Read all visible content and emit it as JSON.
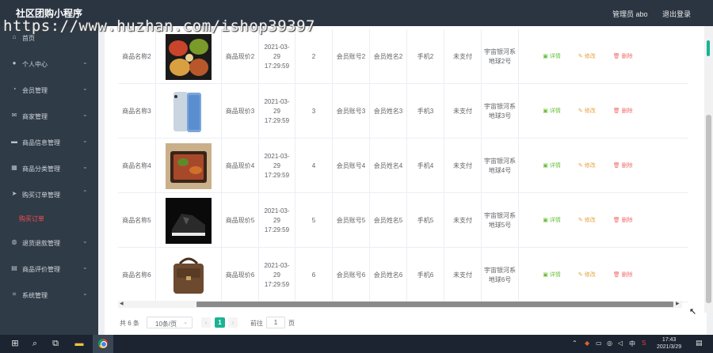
{
  "header": {
    "title": "社区团购小程序",
    "admin": "管理员 abo",
    "logout": "退出登录"
  },
  "watermark": "https://www.huzhan.com/ishop39397",
  "sidebar": {
    "items": [
      {
        "label": "首页",
        "icon": "home-icon"
      },
      {
        "label": "个人中心",
        "icon": "user-icon"
      },
      {
        "label": "会员管理",
        "icon": "help-circle-icon"
      },
      {
        "label": "商家管理",
        "icon": "mail-icon"
      },
      {
        "label": "商品信息管理",
        "icon": "monitor-icon"
      },
      {
        "label": "商品分类管理",
        "icon": "chart-icon"
      },
      {
        "label": "购买订单管理",
        "icon": "send-icon"
      },
      {
        "label": "退货退款管理",
        "icon": "bulb-icon"
      },
      {
        "label": "商品评价管理",
        "icon": "table-icon"
      },
      {
        "label": "系统管理",
        "icon": "crop-icon"
      }
    ],
    "active_sub": "购买订单"
  },
  "table": {
    "rows": [
      {
        "name": "商品名称2",
        "img": "food-tray-image",
        "price": "商品现价2",
        "time": "2021-03-29 17:29:59",
        "qty": "2",
        "account": "会员账号2",
        "member": "会员姓名2",
        "phone": "手机2",
        "status": "未支付",
        "address": "宇宙银河系地球2号"
      },
      {
        "name": "商品名称3",
        "img": "smartphone-image",
        "price": "商品现价3",
        "time": "2021-03-29 17:29:59",
        "qty": "3",
        "account": "会员账号3",
        "member": "会员姓名3",
        "phone": "手机3",
        "status": "未支付",
        "address": "宇宙银河系地球3号"
      },
      {
        "name": "商品名称4",
        "img": "meal-box-image",
        "price": "商品现价4",
        "time": "2021-03-29 17:29:59",
        "qty": "4",
        "account": "会员账号4",
        "member": "会员姓名4",
        "phone": "手机4",
        "status": "未支付",
        "address": "宇宙银河系地球4号"
      },
      {
        "name": "商品名称5",
        "img": "sneaker-image",
        "price": "商品现价5",
        "time": "2021-03-29 17:29:59",
        "qty": "5",
        "account": "会员账号5",
        "member": "会员姓名5",
        "phone": "手机5",
        "status": "未支付",
        "address": "宇宙银河系地球5号"
      },
      {
        "name": "商品名称6",
        "img": "leather-bag-image",
        "price": "商品现价6",
        "time": "2021-03-29 17:29:59",
        "qty": "6",
        "account": "会员账号6",
        "member": "会员姓名6",
        "phone": "手机6",
        "status": "未支付",
        "address": "宇宙银河系地球6号"
      }
    ],
    "actions": {
      "detail": "详情",
      "edit": "修改",
      "delete": "删除"
    }
  },
  "pagination": {
    "total": "共 6 条",
    "page_size": "10条/页",
    "prev": "‹",
    "current": "1",
    "next": "›",
    "goto": "前往",
    "jump_value": "1",
    "page_suffix": "页"
  },
  "taskbar": {
    "tray_lang": "中",
    "time": "17:43",
    "date": "2021/3/29"
  },
  "colors": {
    "topbar": "#2b3542",
    "sidebar": "#2f3b47",
    "active": "#ff4d4f",
    "pager_active": "#19b394",
    "detail": "#67c23a",
    "edit": "#e6a23c",
    "delete": "#f56c6c"
  }
}
